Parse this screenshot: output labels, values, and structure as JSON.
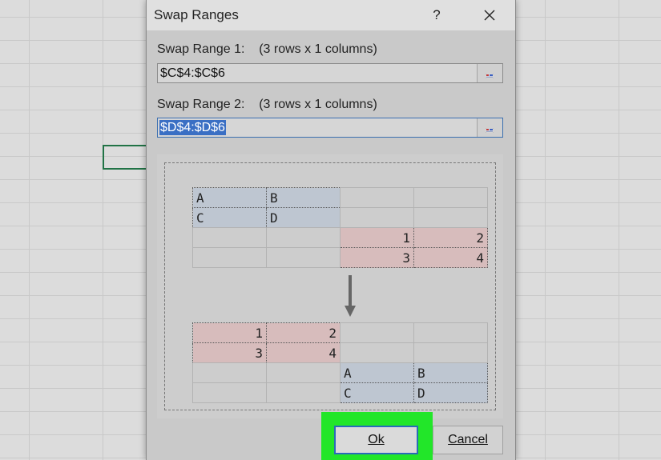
{
  "dialog": {
    "title": "Swap Ranges",
    "help_label": "?"
  },
  "range1": {
    "label": "Swap Range 1:    (3 rows x 1 columns)",
    "value": "$C$4:$C$6"
  },
  "range2": {
    "label": "Swap Range 2:    (3 rows x 1 columns)",
    "value": "$D$4:$D$6"
  },
  "preview": {
    "before": [
      [
        "A",
        "B",
        "",
        ""
      ],
      [
        "C",
        "D",
        "",
        ""
      ],
      [
        "",
        "",
        "1",
        "2"
      ],
      [
        "",
        "",
        "3",
        "4"
      ]
    ],
    "after": [
      [
        "1",
        "2",
        "",
        ""
      ],
      [
        "3",
        "4",
        "",
        ""
      ],
      [
        "",
        "",
        "A",
        "B"
      ],
      [
        "",
        "",
        "C",
        "D"
      ]
    ]
  },
  "buttons": {
    "ok_label": "Ok",
    "cancel_label": "Cancel"
  },
  "colors": {
    "highlight": "#22e629",
    "selection": "#3a6fc4",
    "range_blue": "#bec6d1",
    "range_red": "#d7bcbc",
    "active_cell_border": "#217346"
  },
  "icons": {
    "close": "close-icon",
    "range_picker": "range-select-icon",
    "arrow": "arrow-down-icon"
  }
}
